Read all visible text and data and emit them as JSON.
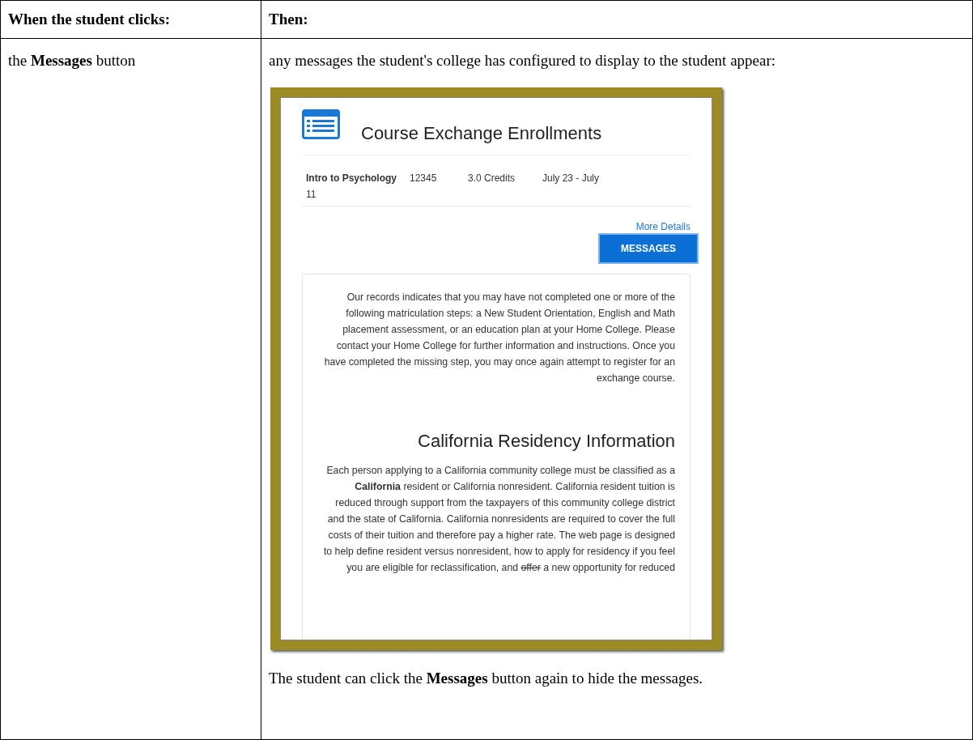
{
  "table": {
    "columns": [
      "When the student clicks:",
      "Then:"
    ],
    "rows": [
      {
        "trigger": "the **Messages** button",
        "intro": "any messages the student's college has configured to display to the student appear:",
        "screenshot": {
          "title": "Course Exchange Enrollments",
          "enrollment": {
            "course": "Intro to Psychology",
            "number": "12345",
            "credits": "3.0 Credits",
            "dates": "July 23 - July",
            "dates_cont": "11"
          },
          "link": "More Details",
          "button": "MESSAGES",
          "message": "Our records indicates that you may have not completed one or more of the following matriculation steps: a New Student Orientation, English and Math placement assessment, or an education plan at your Home College.  Please contact your Home College for further information and instructions. Once you have completed the missing step, you may once again attempt to register for an exchange course.",
          "heading": "California Residency Information",
          "residency": [
            {
              "text": "Each person applying to a California community college must be classified as a **California** resident or California nonresident. California resident tuition is reduced through support from the taxpayers of this community college district and the state of California. California nonresidents are required to cover the full costs of their tuition and therefore pay a higher rate. The web page is designed to help define resident versus nonresident, how to apply for residency if you feel you are eligible for reclassification, and ",
              "struck": false
            },
            {
              "text": "offer",
              "struck": true
            },
            {
              "text": " a new opportunity for reduced",
              "struck": false
            }
          ]
        },
        "outro": "The student can click the **Messages** button again to hide the messages."
      }
    ]
  }
}
